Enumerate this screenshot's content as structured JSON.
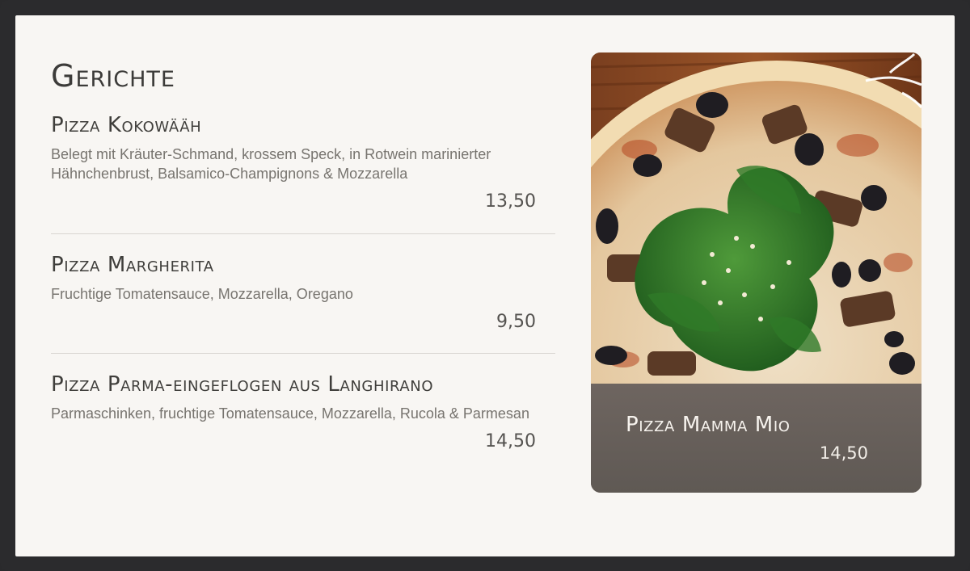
{
  "menu": {
    "section_title": "Gerichte",
    "items": [
      {
        "name": "Pizza Kokowääh",
        "description": "Belegt mit Kräuter-Schmand, krossem Speck, in Rotwein marinierter Hähnchenbrust,   Balsamico-Champignons & Mozzarella",
        "price": "13,50"
      },
      {
        "name": "Pizza Margherita",
        "description": "Fruchtige Tomatensauce, Mozzarella, Oregano",
        "price": "9,50"
      },
      {
        "name": "Pizza Parma-eingeflogen aus Langhirano",
        "description": "Parmaschinken, fruchtige Tomatensauce, Mozzarella, Rucola & Parmesan",
        "price": "14,50"
      }
    ]
  },
  "feature": {
    "image_icon": "pizza-photo",
    "name": "Pizza Mamma Mio",
    "price": "14,50"
  },
  "colors": {
    "background": "#f8f6f3",
    "frame": "#2b2b2d",
    "title_text": "#3c3b39",
    "description_text": "#77746f",
    "divider": "#d9d6d1",
    "caption_overlay": "#635c57"
  }
}
